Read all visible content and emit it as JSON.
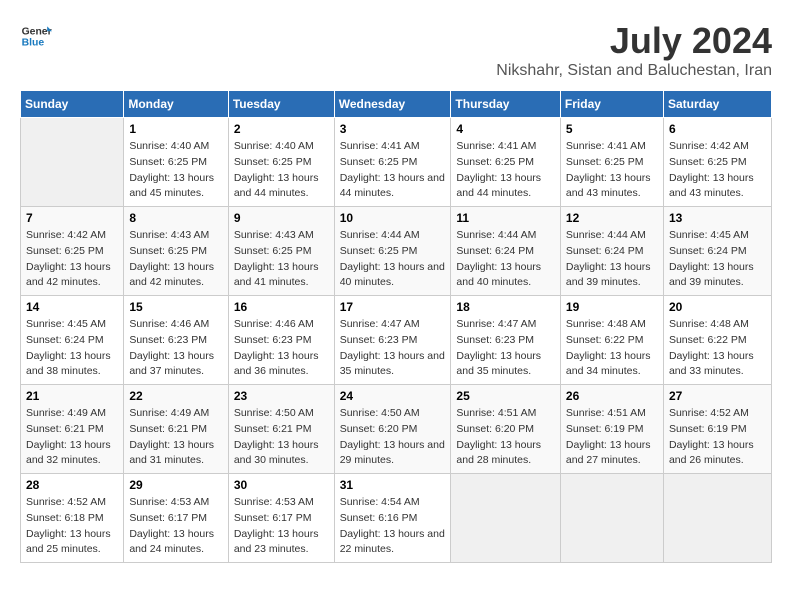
{
  "header": {
    "logo_general": "General",
    "logo_blue": "Blue",
    "main_title": "July 2024",
    "subtitle": "Nikshahr, Sistan and Baluchestan, Iran"
  },
  "calendar": {
    "days_of_week": [
      "Sunday",
      "Monday",
      "Tuesday",
      "Wednesday",
      "Thursday",
      "Friday",
      "Saturday"
    ],
    "weeks": [
      [
        {
          "day": "",
          "empty": true
        },
        {
          "day": "1",
          "sunrise": "Sunrise: 4:40 AM",
          "sunset": "Sunset: 6:25 PM",
          "daylight": "Daylight: 13 hours and 45 minutes."
        },
        {
          "day": "2",
          "sunrise": "Sunrise: 4:40 AM",
          "sunset": "Sunset: 6:25 PM",
          "daylight": "Daylight: 13 hours and 44 minutes."
        },
        {
          "day": "3",
          "sunrise": "Sunrise: 4:41 AM",
          "sunset": "Sunset: 6:25 PM",
          "daylight": "Daylight: 13 hours and 44 minutes."
        },
        {
          "day": "4",
          "sunrise": "Sunrise: 4:41 AM",
          "sunset": "Sunset: 6:25 PM",
          "daylight": "Daylight: 13 hours and 44 minutes."
        },
        {
          "day": "5",
          "sunrise": "Sunrise: 4:41 AM",
          "sunset": "Sunset: 6:25 PM",
          "daylight": "Daylight: 13 hours and 43 minutes."
        },
        {
          "day": "6",
          "sunrise": "Sunrise: 4:42 AM",
          "sunset": "Sunset: 6:25 PM",
          "daylight": "Daylight: 13 hours and 43 minutes."
        }
      ],
      [
        {
          "day": "7",
          "sunrise": "Sunrise: 4:42 AM",
          "sunset": "Sunset: 6:25 PM",
          "daylight": "Daylight: 13 hours and 42 minutes."
        },
        {
          "day": "8",
          "sunrise": "Sunrise: 4:43 AM",
          "sunset": "Sunset: 6:25 PM",
          "daylight": "Daylight: 13 hours and 42 minutes."
        },
        {
          "day": "9",
          "sunrise": "Sunrise: 4:43 AM",
          "sunset": "Sunset: 6:25 PM",
          "daylight": "Daylight: 13 hours and 41 minutes."
        },
        {
          "day": "10",
          "sunrise": "Sunrise: 4:44 AM",
          "sunset": "Sunset: 6:25 PM",
          "daylight": "Daylight: 13 hours and 40 minutes."
        },
        {
          "day": "11",
          "sunrise": "Sunrise: 4:44 AM",
          "sunset": "Sunset: 6:24 PM",
          "daylight": "Daylight: 13 hours and 40 minutes."
        },
        {
          "day": "12",
          "sunrise": "Sunrise: 4:44 AM",
          "sunset": "Sunset: 6:24 PM",
          "daylight": "Daylight: 13 hours and 39 minutes."
        },
        {
          "day": "13",
          "sunrise": "Sunrise: 4:45 AM",
          "sunset": "Sunset: 6:24 PM",
          "daylight": "Daylight: 13 hours and 39 minutes."
        }
      ],
      [
        {
          "day": "14",
          "sunrise": "Sunrise: 4:45 AM",
          "sunset": "Sunset: 6:24 PM",
          "daylight": "Daylight: 13 hours and 38 minutes."
        },
        {
          "day": "15",
          "sunrise": "Sunrise: 4:46 AM",
          "sunset": "Sunset: 6:23 PM",
          "daylight": "Daylight: 13 hours and 37 minutes."
        },
        {
          "day": "16",
          "sunrise": "Sunrise: 4:46 AM",
          "sunset": "Sunset: 6:23 PM",
          "daylight": "Daylight: 13 hours and 36 minutes."
        },
        {
          "day": "17",
          "sunrise": "Sunrise: 4:47 AM",
          "sunset": "Sunset: 6:23 PM",
          "daylight": "Daylight: 13 hours and 35 minutes."
        },
        {
          "day": "18",
          "sunrise": "Sunrise: 4:47 AM",
          "sunset": "Sunset: 6:23 PM",
          "daylight": "Daylight: 13 hours and 35 minutes."
        },
        {
          "day": "19",
          "sunrise": "Sunrise: 4:48 AM",
          "sunset": "Sunset: 6:22 PM",
          "daylight": "Daylight: 13 hours and 34 minutes."
        },
        {
          "day": "20",
          "sunrise": "Sunrise: 4:48 AM",
          "sunset": "Sunset: 6:22 PM",
          "daylight": "Daylight: 13 hours and 33 minutes."
        }
      ],
      [
        {
          "day": "21",
          "sunrise": "Sunrise: 4:49 AM",
          "sunset": "Sunset: 6:21 PM",
          "daylight": "Daylight: 13 hours and 32 minutes."
        },
        {
          "day": "22",
          "sunrise": "Sunrise: 4:49 AM",
          "sunset": "Sunset: 6:21 PM",
          "daylight": "Daylight: 13 hours and 31 minutes."
        },
        {
          "day": "23",
          "sunrise": "Sunrise: 4:50 AM",
          "sunset": "Sunset: 6:21 PM",
          "daylight": "Daylight: 13 hours and 30 minutes."
        },
        {
          "day": "24",
          "sunrise": "Sunrise: 4:50 AM",
          "sunset": "Sunset: 6:20 PM",
          "daylight": "Daylight: 13 hours and 29 minutes."
        },
        {
          "day": "25",
          "sunrise": "Sunrise: 4:51 AM",
          "sunset": "Sunset: 6:20 PM",
          "daylight": "Daylight: 13 hours and 28 minutes."
        },
        {
          "day": "26",
          "sunrise": "Sunrise: 4:51 AM",
          "sunset": "Sunset: 6:19 PM",
          "daylight": "Daylight: 13 hours and 27 minutes."
        },
        {
          "day": "27",
          "sunrise": "Sunrise: 4:52 AM",
          "sunset": "Sunset: 6:19 PM",
          "daylight": "Daylight: 13 hours and 26 minutes."
        }
      ],
      [
        {
          "day": "28",
          "sunrise": "Sunrise: 4:52 AM",
          "sunset": "Sunset: 6:18 PM",
          "daylight": "Daylight: 13 hours and 25 minutes."
        },
        {
          "day": "29",
          "sunrise": "Sunrise: 4:53 AM",
          "sunset": "Sunset: 6:17 PM",
          "daylight": "Daylight: 13 hours and 24 minutes."
        },
        {
          "day": "30",
          "sunrise": "Sunrise: 4:53 AM",
          "sunset": "Sunset: 6:17 PM",
          "daylight": "Daylight: 13 hours and 23 minutes."
        },
        {
          "day": "31",
          "sunrise": "Sunrise: 4:54 AM",
          "sunset": "Sunset: 6:16 PM",
          "daylight": "Daylight: 13 hours and 22 minutes."
        },
        {
          "day": "",
          "empty": true
        },
        {
          "day": "",
          "empty": true
        },
        {
          "day": "",
          "empty": true
        }
      ]
    ]
  }
}
